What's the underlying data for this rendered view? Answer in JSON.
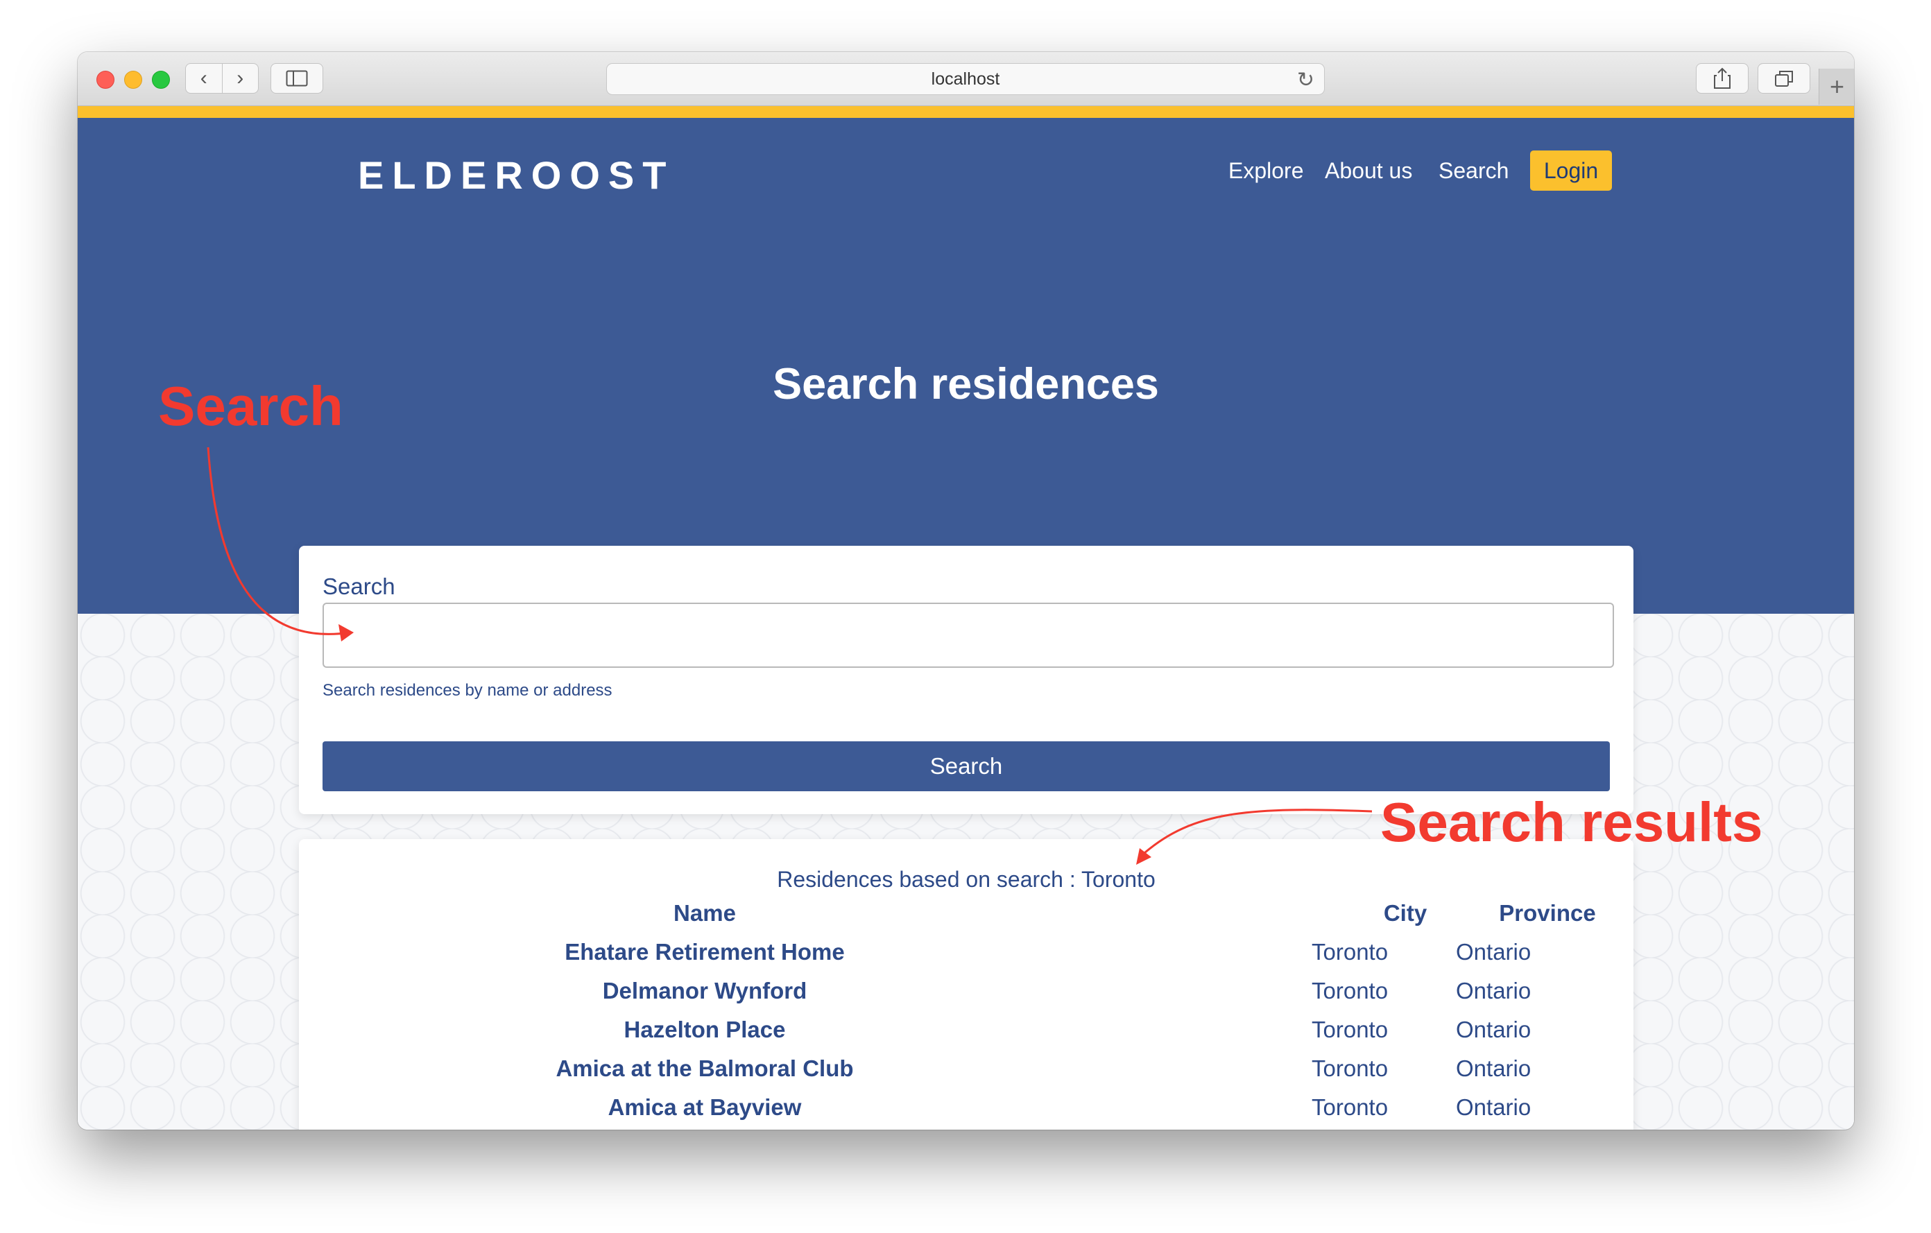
{
  "browser": {
    "url": "localhost",
    "icons": {
      "back": "chevron-left-icon",
      "forward": "chevron-right-icon",
      "sidebar": "sidebar-icon",
      "reload": "reload-icon",
      "share": "share-icon",
      "tabs": "tabs-icon",
      "new_tab": "plus-icon"
    }
  },
  "site": {
    "logo": "ELDEROOST",
    "nav": {
      "explore": "Explore",
      "about": "About us",
      "search": "Search",
      "login": "Login"
    },
    "hero_title": "Search residences",
    "colors": {
      "primary": "#3d5a95",
      "accent": "#fbc02d",
      "annotation": "#f23a2f"
    }
  },
  "search_form": {
    "label": "Search",
    "value": "",
    "helper": "Search residences by name or address",
    "button": "Search"
  },
  "results": {
    "heading": "Residences based on search : Toronto",
    "columns": {
      "name": "Name",
      "city": "City",
      "province": "Province"
    },
    "rows": [
      {
        "name": "Ehatare Retirement Home",
        "city": "Toronto",
        "province": "Ontario"
      },
      {
        "name": "Delmanor Wynford",
        "city": "Toronto",
        "province": "Ontario"
      },
      {
        "name": "Hazelton Place",
        "city": "Toronto",
        "province": "Ontario"
      },
      {
        "name": "Amica at the Balmoral Club",
        "city": "Toronto",
        "province": "Ontario"
      },
      {
        "name": "Amica at Bayview",
        "city": "Toronto",
        "province": "Ontario"
      }
    ]
  },
  "annotations": {
    "search": "Search",
    "results": "Search results"
  }
}
